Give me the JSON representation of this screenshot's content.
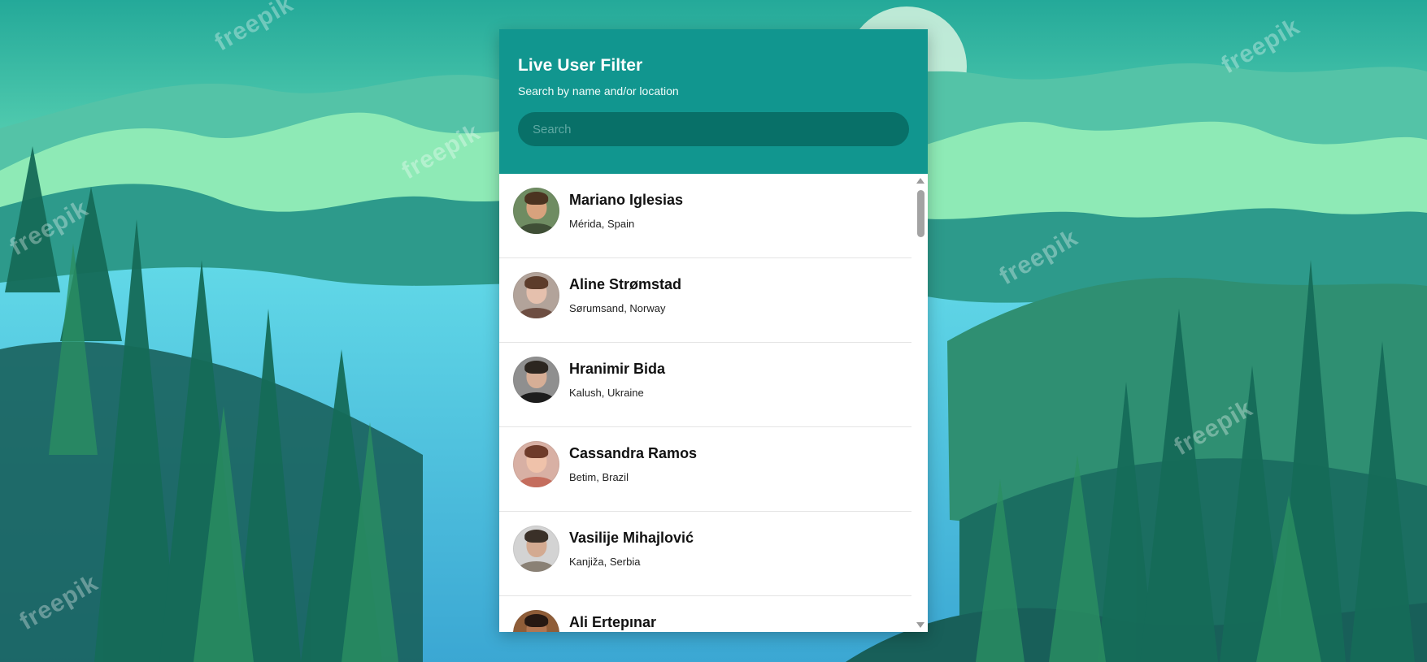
{
  "header": {
    "title": "Live User Filter",
    "subtitle": "Search by name and/or location"
  },
  "search": {
    "placeholder": "Search",
    "value": ""
  },
  "users": [
    {
      "name": "Mariano Iglesias",
      "location": "Mérida, Spain",
      "avatar_colors": {
        "background": "#6f8c62",
        "skin": "#d8a27d",
        "hair": "#4b3320",
        "clothes": "#3f4f36"
      }
    },
    {
      "name": "Aline Strømstad",
      "location": "Sørumsand, Norway",
      "avatar_colors": {
        "background": "#b2a39a",
        "skin": "#e5c0ad",
        "hair": "#5c3c2b",
        "clothes": "#6d4e42"
      }
    },
    {
      "name": "Hranimir Bida",
      "location": "Kalush, Ukraine",
      "avatar_colors": {
        "background": "#8f8f8f",
        "skin": "#d6ae96",
        "hair": "#2c2620",
        "clothes": "#1d1d1d"
      }
    },
    {
      "name": "Cassandra Ramos",
      "location": "Betim, Brazil",
      "avatar_colors": {
        "background": "#d8b0a4",
        "skin": "#efc2aa",
        "hair": "#6e3b2a",
        "clothes": "#c46d5d"
      }
    },
    {
      "name": "Vasilije Mihajlović",
      "location": "Kanjiža, Serbia",
      "avatar_colors": {
        "background": "#d3d3d3",
        "skin": "#d3aa91",
        "hair": "#3a3028",
        "clothes": "#8a8175"
      }
    },
    {
      "name": "Ali Ertepınar",
      "location": "",
      "avatar_colors": {
        "background": "#8f5d38",
        "skin": "#b07652",
        "hair": "#261812",
        "clothes": "#1d2d2d"
      }
    }
  ],
  "watermarks": [
    "freepik",
    "freepik",
    "freepik",
    "freepik",
    "freepik",
    "freepik",
    "freepik"
  ],
  "colors": {
    "header_bg": "#11968f",
    "search_bg": "#087068",
    "card_bg": "#ffffff"
  }
}
